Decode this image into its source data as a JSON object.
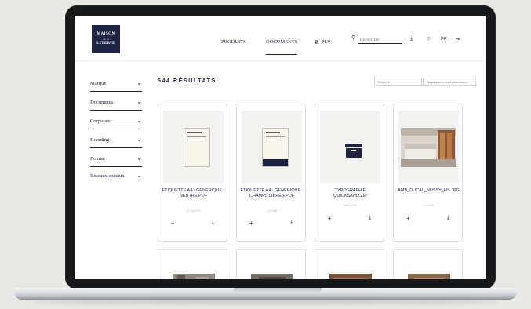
{
  "header": {
    "logo": {
      "line1": "MAISON",
      "line2": "de la",
      "line3": "LITERIE"
    },
    "nav": [
      "PRODUITS",
      "DOCUMENTS",
      "PLV"
    ],
    "search_placeholder": "Rechercher",
    "lang": "FR"
  },
  "sidebar": {
    "items": [
      "Marque",
      "Documents",
      "Corporate",
      "Branding",
      "Format",
      "Réseaux sociaux"
    ]
  },
  "results": {
    "count_label": "544 RÉSULTATS",
    "search_placeholder": "Entrer le",
    "sort_label": "Du plus récent au plus ancien"
  },
  "cards": [
    {
      "title": "ETIQUETTE A4 - GENERIQUE - NEUTRE.PDF",
      "size": "171.43 KB"
    },
    {
      "title": "ETIQUETTE A4 - GENERIQUE - CHAMPS LIBRES.PDF",
      "size": "1.21 MB"
    },
    {
      "title": "TYPOGRAPHIE QUICKSAND.ZIP",
      "size": "260.01 KB"
    },
    {
      "title": "AMB_DUCAL_NUSSY_HS.JPG",
      "size": "2.02 MB"
    }
  ],
  "colors": {
    "brand": "#1d2340",
    "border": "#e4e4e4"
  },
  "icons": {
    "search": "search-icon",
    "chevron": "chevron-down-icon",
    "add": "plus-icon",
    "download": "download-icon",
    "user": "user-icon",
    "logout": "logout-icon",
    "external": "external-link-icon"
  }
}
